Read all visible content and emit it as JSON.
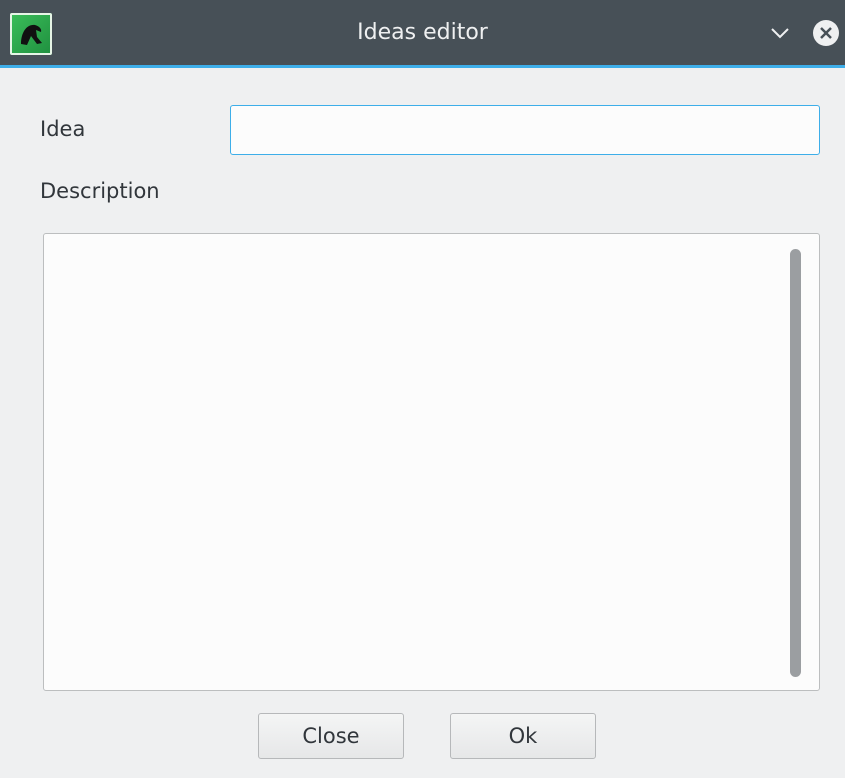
{
  "window": {
    "title": "Ideas editor",
    "accent_color": "#3daee9",
    "titlebar_color": "#475057",
    "app_icon": "app-logo-icon",
    "controls": [
      "chevron-down-icon",
      "close-circle-icon"
    ]
  },
  "form": {
    "idea_label": "Idea",
    "idea_value": "",
    "description_label": "Description",
    "description_value": ""
  },
  "buttons": {
    "close_label": "Close",
    "ok_label": "Ok"
  }
}
